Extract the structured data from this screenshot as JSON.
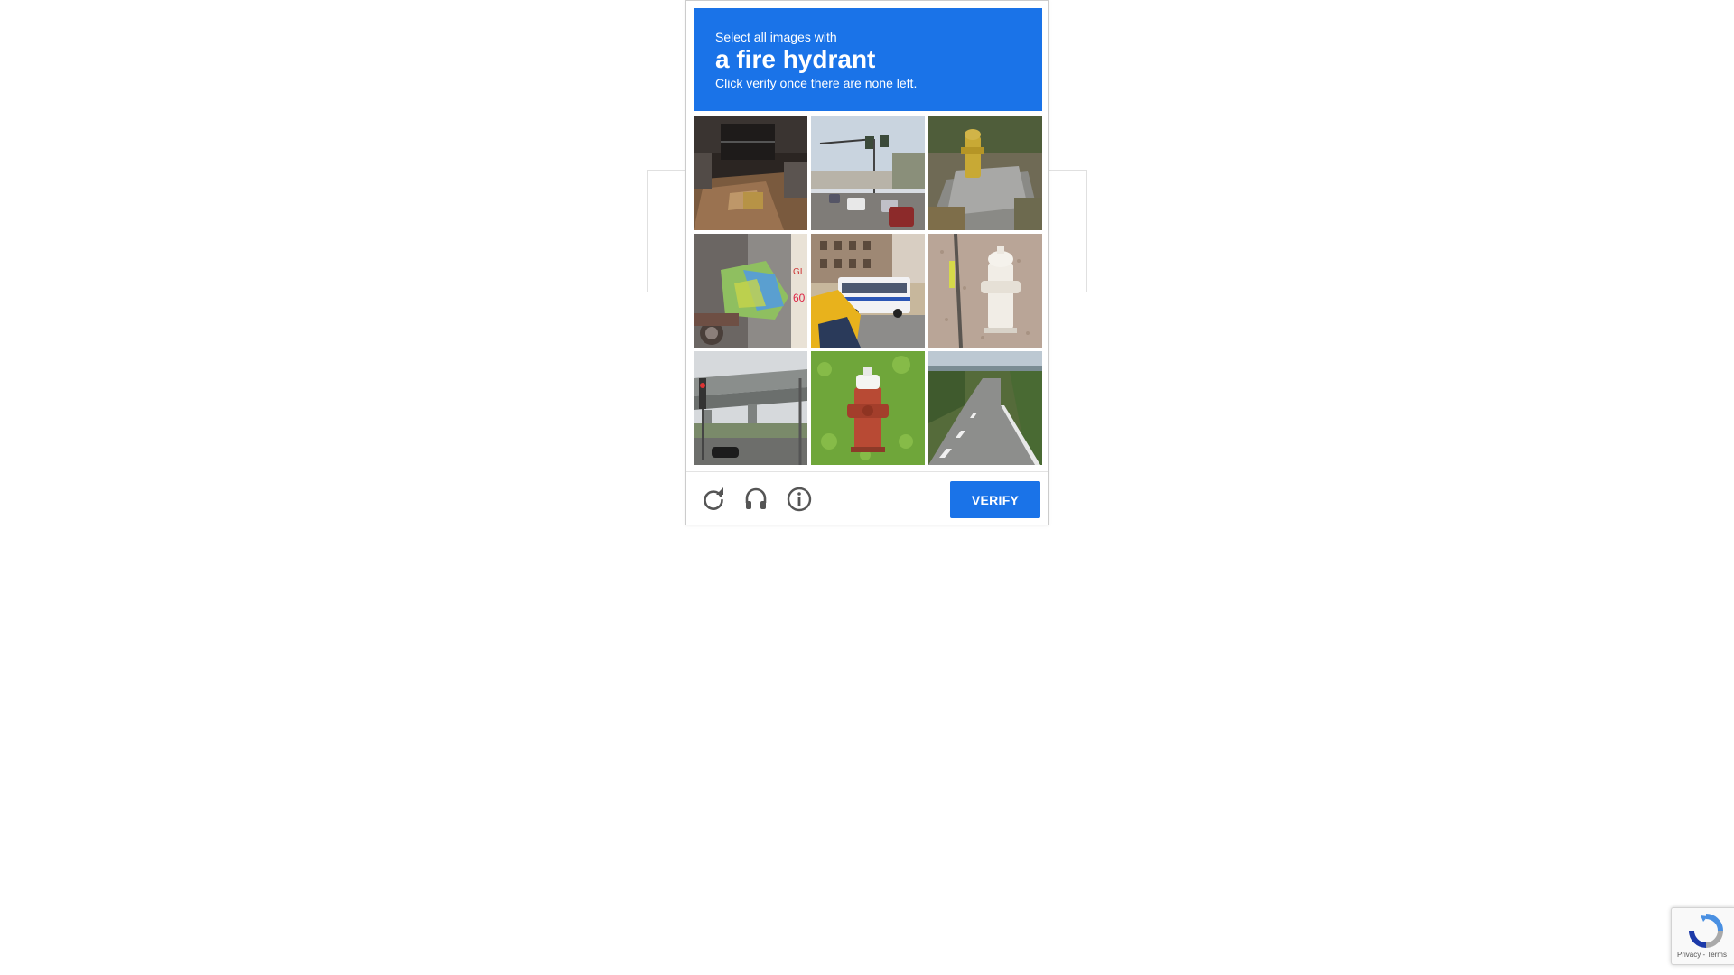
{
  "challenge": {
    "instruction": "Select all images with",
    "target": "a fire hydrant",
    "hint": "Click verify once there are none left."
  },
  "tiles": [
    {
      "subject": "cafe interior with chairs and table"
    },
    {
      "subject": "street intersection with traffic lights and cars"
    },
    {
      "subject": "yellow fire hydrant"
    },
    {
      "subject": "scooter covered with cloth"
    },
    {
      "subject": "city bus and taxi"
    },
    {
      "subject": "white fire hydrant on gravel"
    },
    {
      "subject": "highway overpass with traffic light"
    },
    {
      "subject": "red fire hydrant on grass"
    },
    {
      "subject": "winding road"
    }
  ],
  "footer": {
    "reload_icon": "reload-icon",
    "audio_icon": "headphones-icon",
    "info_icon": "info-icon",
    "verify_label": "VERIFY"
  },
  "badge": {
    "terms": "Privacy - Terms"
  },
  "colors": {
    "accent": "#1a73e8"
  }
}
